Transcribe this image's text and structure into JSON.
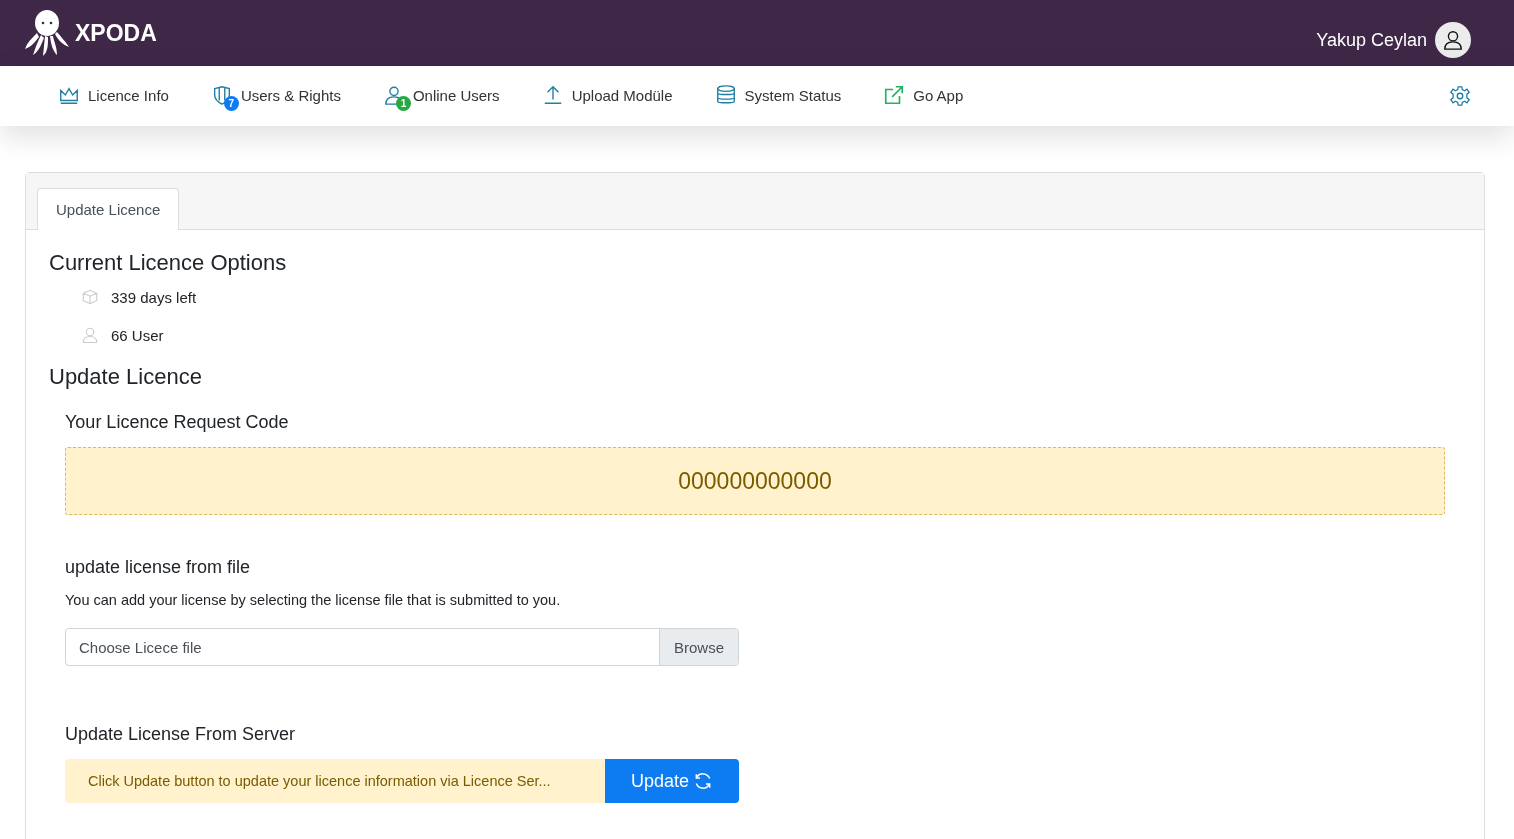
{
  "header": {
    "brand": "XPODA",
    "user_name": "Yakup Ceylan"
  },
  "nav": [
    {
      "label": "Licence Info"
    },
    {
      "label": "Users & Rights",
      "badge": {
        "text": "7",
        "color": "#0d7bf2"
      }
    },
    {
      "label": "Online Users",
      "badge": {
        "text": "1",
        "color": "#28a745"
      }
    },
    {
      "label": "Upload Modüle"
    },
    {
      "label": "System Status"
    },
    {
      "label": "Go App"
    }
  ],
  "tabs": [
    {
      "label": "Update Licence",
      "selected": true
    }
  ],
  "current_options": {
    "title": "Current Licence Options",
    "items": [
      "339 days left",
      "66 User"
    ]
  },
  "update": {
    "title": "Update Licence",
    "request_code_label": "Your Licence Request Code",
    "request_code": "000000000000",
    "file_section": {
      "title": "update license from file",
      "description": "You can add your license by selecting the license file that is submitted to you.",
      "placeholder": "Choose Licece file",
      "browse": "Browse"
    },
    "server_section": {
      "title": "Update License From Server",
      "message": "Click Update button to update your licence information via Licence Ser...",
      "button": "Update"
    }
  }
}
